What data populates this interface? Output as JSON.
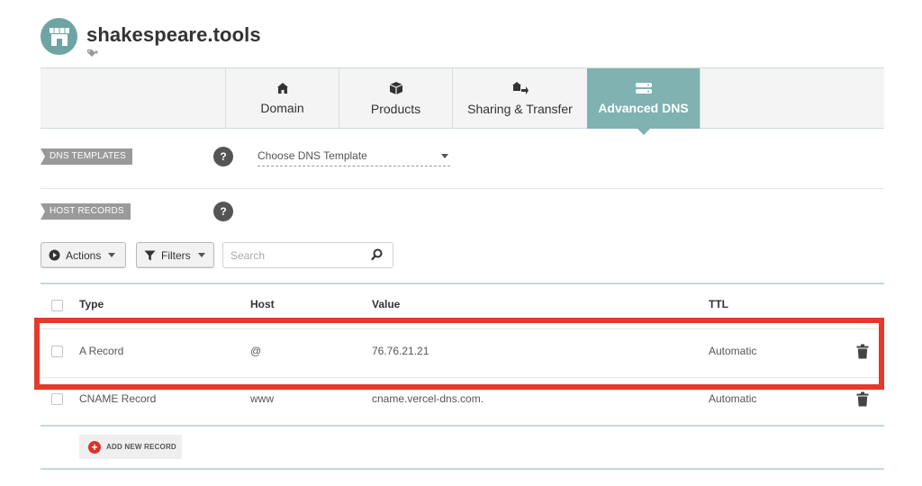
{
  "domain": {
    "name": "shakespeare.tools"
  },
  "tabs": [
    {
      "label": "Domain",
      "icon": "house-icon"
    },
    {
      "label": "Products",
      "icon": "box-icon"
    },
    {
      "label": "Sharing & Transfer",
      "icon": "transfer-icon"
    },
    {
      "label": "Advanced DNS",
      "icon": "server-icon",
      "active": true
    }
  ],
  "dns_templates": {
    "label": "DNS TEMPLATES",
    "select_value": "Choose DNS Template"
  },
  "host_records": {
    "label": "HOST RECORDS",
    "actions_label": "Actions",
    "filters_label": "Filters",
    "search_placeholder": "Search",
    "columns": {
      "type": "Type",
      "host": "Host",
      "value": "Value",
      "ttl": "TTL"
    },
    "rows": [
      {
        "type": "A Record",
        "host": "@",
        "value": "76.76.21.21",
        "ttl": "Automatic"
      },
      {
        "type": "CNAME Record",
        "host": "www",
        "value": "cname.vercel-dns.com.",
        "ttl": "Automatic"
      }
    ],
    "add_label": "ADD NEW RECORD"
  },
  "colors": {
    "accent": "#7fb2b1",
    "highlight": "#e33a2a",
    "add": "#d9352b"
  }
}
